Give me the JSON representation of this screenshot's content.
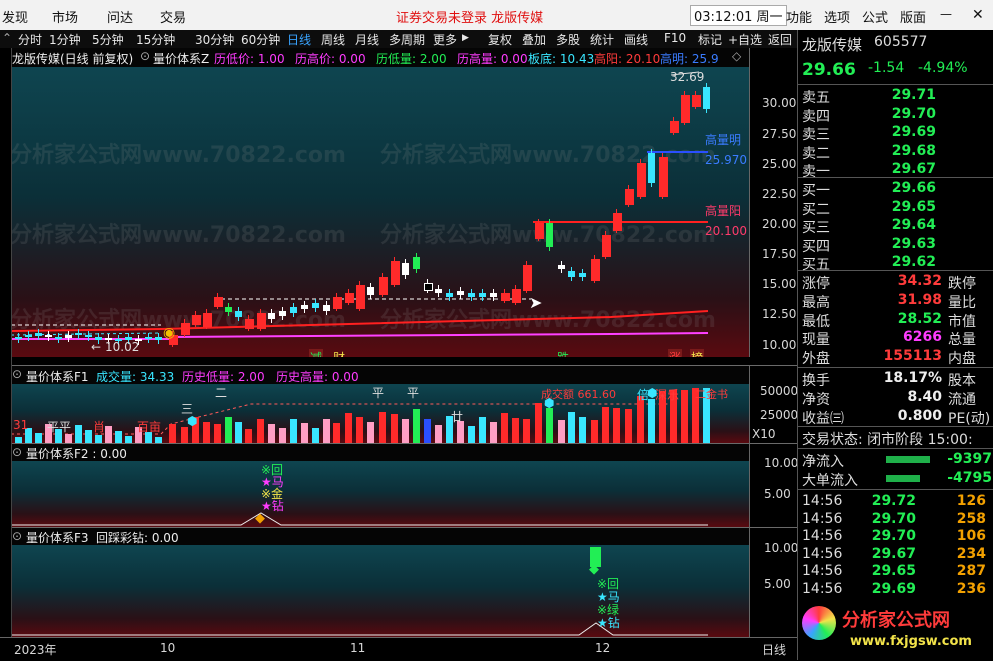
{
  "menu": {
    "items": [
      "发现",
      "市场",
      "问达",
      "交易"
    ],
    "status_msg": "证券交易未登录  龙版传媒",
    "clock": "03:12:01 周一",
    "right_items": [
      "功能",
      "选项",
      "公式",
      "版面"
    ]
  },
  "toolbar": {
    "periods": [
      "分时",
      "1分钟",
      "5分钟",
      "15分钟",
      "30分钟",
      "60分钟",
      "日线",
      "周线",
      "月线",
      "多周期",
      "更多"
    ],
    "active_period": "日线",
    "tools": [
      "复权",
      "叠加",
      "多股",
      "统计",
      "画线",
      "F10",
      "标记",
      "+自选",
      "返回"
    ]
  },
  "main_header": {
    "title": "龙版传媒(日线 前复权)",
    "indicator": "量价体系Z",
    "fields": [
      {
        "text": "历低价: 1.00",
        "color": "#ff3cff"
      },
      {
        "text": "历高价: 0.00",
        "color": "#ff3cff"
      },
      {
        "text": "历低量: 2.00",
        "color": "#22ee55"
      },
      {
        "text": "历高量: 0.00",
        "color": "#ff3cff"
      },
      {
        "text": "板底: 10.43",
        "color": "#39e6ff"
      },
      {
        "text": "高阳: 20.10",
        "color": "#ff3b3b"
      }
    ],
    "truncated_label": "高明: 25.9"
  },
  "main_chart": {
    "y_ticks": [
      "30.00",
      "27.50",
      "25.00",
      "22.50",
      "20.00",
      "17.50",
      "15.00",
      "12.50",
      "10.00"
    ],
    "peak_label": "32.69",
    "low_label": "10.02",
    "gaoliangming": {
      "label": "高量明",
      "value": "25.970"
    },
    "gaoliangyang": {
      "label": "高量阳",
      "value": "20.100"
    },
    "signals": [
      {
        "text": "减",
        "color": "#22ee55"
      },
      {
        "text": "财",
        "color": "#f2e34a"
      },
      {
        "text": "跌",
        "color": "#22ee55"
      },
      {
        "text": "涨",
        "color": "#ff3b3b"
      },
      {
        "text": "榜",
        "color": "#f2e34a"
      }
    ]
  },
  "f1": {
    "title": "量价体系F1",
    "fields": [
      {
        "text": "成交量: 34.33",
        "color": "#39e6ff"
      },
      {
        "text": "历史低量: 2.00",
        "color": "#ff3cff"
      },
      {
        "text": "历史高量: 0.00",
        "color": "#ff3cff"
      }
    ],
    "y_ticks": [
      "50000",
      "25000"
    ],
    "unit": "X10",
    "labels": [
      {
        "text": "31",
        "color": "#ff3b3b"
      },
      {
        "text": "平平",
        "color": "#ddd"
      },
      {
        "text": "肖",
        "color": "#ff3b3b"
      },
      {
        "text": "百亩",
        "color": "#ff3b3b"
      },
      {
        "text": "三",
        "color": "#ddd"
      },
      {
        "text": "二",
        "color": "#ddd"
      },
      {
        "text": "平",
        "color": "#ddd"
      },
      {
        "text": "平",
        "color": "#ddd"
      },
      {
        "text": "廿",
        "color": "#ddd"
      },
      {
        "text": "成交额 661.60",
        "color": "#ff3b3b"
      },
      {
        "text": "倍",
        "color": "#39e6ff"
      },
      {
        "text": "深乐",
        "color": "#ff3b3b"
      },
      {
        "text": "二金书",
        "color": "#ff3b3b"
      }
    ]
  },
  "f2": {
    "title": "量价体系F2 : 0.00",
    "y_ticks": [
      "10.00",
      "5.00"
    ],
    "tags": [
      "※回",
      "★马",
      "※金",
      "★钻"
    ]
  },
  "f3": {
    "title": "量价体系F3",
    "subtitle": "回踩彩钻: 0.00",
    "y_ticks": [
      "10.00",
      "5.00"
    ],
    "tags": [
      "※回",
      "★马",
      "※绿",
      "★钻"
    ]
  },
  "x_axis": {
    "labels": [
      "2023年",
      "10",
      "11",
      "12"
    ],
    "corner": "日线"
  },
  "watermark": "分析家公式网www.70822.com",
  "quote": {
    "name": "龙版传媒",
    "code": "605577",
    "price": "29.66",
    "change": "-1.54",
    "change_pct": "-4.94%",
    "asks": [
      {
        "label": "卖五",
        "price": "29.71",
        "vol": "1"
      },
      {
        "label": "卖四",
        "price": "29.70",
        "vol": "1"
      },
      {
        "label": "卖三",
        "price": "29.69",
        "vol": "1"
      },
      {
        "label": "卖二",
        "price": "29.68",
        "vol": "1"
      },
      {
        "label": "卖一",
        "price": "29.67",
        "vol": "1"
      }
    ],
    "bids": [
      {
        "label": "买一",
        "price": "29.66",
        "vol": "1"
      },
      {
        "label": "买二",
        "price": "29.65",
        "vol": "1"
      },
      {
        "label": "买三",
        "price": "29.64",
        "vol": "1"
      },
      {
        "label": "买四",
        "price": "29.63",
        "vol": "1"
      },
      {
        "label": "买五",
        "price": "29.62",
        "vol": "1"
      }
    ],
    "stats": [
      {
        "l": "涨停",
        "v": "34.32",
        "vc": "#ff3b3b",
        "r": "跌停"
      },
      {
        "l": "最高",
        "v": "31.98",
        "vc": "#ff3b3b",
        "r": "量比"
      },
      {
        "l": "最低",
        "v": "28.52",
        "vc": "#22ee55",
        "r": "市值"
      },
      {
        "l": "现量",
        "v": "6266",
        "vc": "#ff3cff",
        "r": "总量"
      },
      {
        "l": "外盘",
        "v": "155113",
        "vc": "#ff3b3b",
        "r": "内盘"
      }
    ],
    "stats2": [
      {
        "l": "换手",
        "v": "18.17%",
        "vc": "#eee",
        "r": "股本"
      },
      {
        "l": "净资",
        "v": "8.40",
        "vc": "#eee",
        "r": "流通"
      },
      {
        "l": "收益㈢",
        "v": "0.800",
        "vc": "#eee",
        "r": "PE(动)"
      }
    ],
    "trade_state": "交易状态: 闭市阶段 15:00:",
    "flows": [
      {
        "l": "净流入",
        "v": "-9397"
      },
      {
        "l": "大单流入",
        "v": "-4795"
      }
    ],
    "ticks": [
      {
        "t": "14:56",
        "p": "29.72",
        "v": "126"
      },
      {
        "t": "14:56",
        "p": "29.70",
        "v": "258"
      },
      {
        "t": "14:56",
        "p": "29.70",
        "v": "106"
      },
      {
        "t": "14:56",
        "p": "29.67",
        "v": "234"
      },
      {
        "t": "14:56",
        "p": "29.65",
        "v": "287"
      },
      {
        "t": "14:56",
        "p": "29.69",
        "v": "236"
      }
    ],
    "logo_text": "分析家公式网",
    "logo_url": "www.fxjgsw.com"
  }
}
